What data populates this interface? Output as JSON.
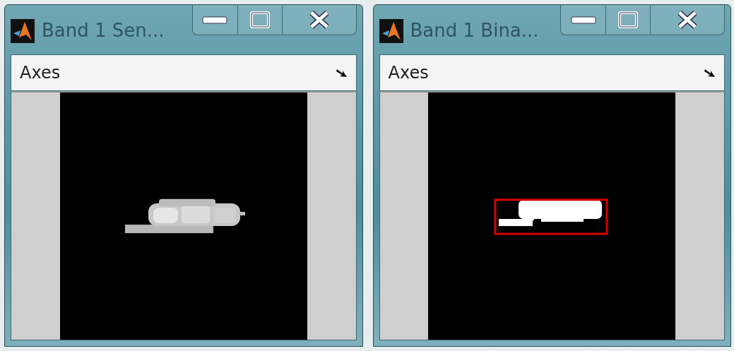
{
  "windows": [
    {
      "title": "Band 1 Sen...",
      "panel_title": "Axes",
      "kind": "grayscale"
    },
    {
      "title": "Band 1 Bina...",
      "panel_title": "Axes",
      "kind": "binary"
    }
  ]
}
